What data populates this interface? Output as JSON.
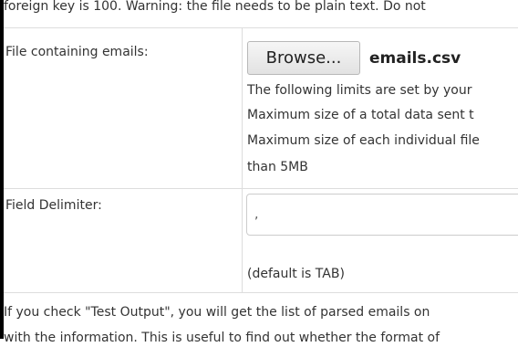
{
  "top_note": "foreign key is 100. Warning: the file needs to be plain text. Do not",
  "file_row": {
    "label": "File containing emails:",
    "browse_label": "Browse...",
    "selected_file": "emails.csv",
    "limits": [
      "The following limits are set by your",
      "Maximum size of a total data sent t",
      "Maximum size of each individual file",
      "than 5MB"
    ]
  },
  "delimiter_row": {
    "label": "Field Delimiter:",
    "value": ",",
    "note": "(default is TAB)"
  },
  "bottom_note": "If you check \"Test Output\", you will get the list of parsed emails on",
  "bottom_note_cut": "with the information. This is useful to find out whether the format of"
}
